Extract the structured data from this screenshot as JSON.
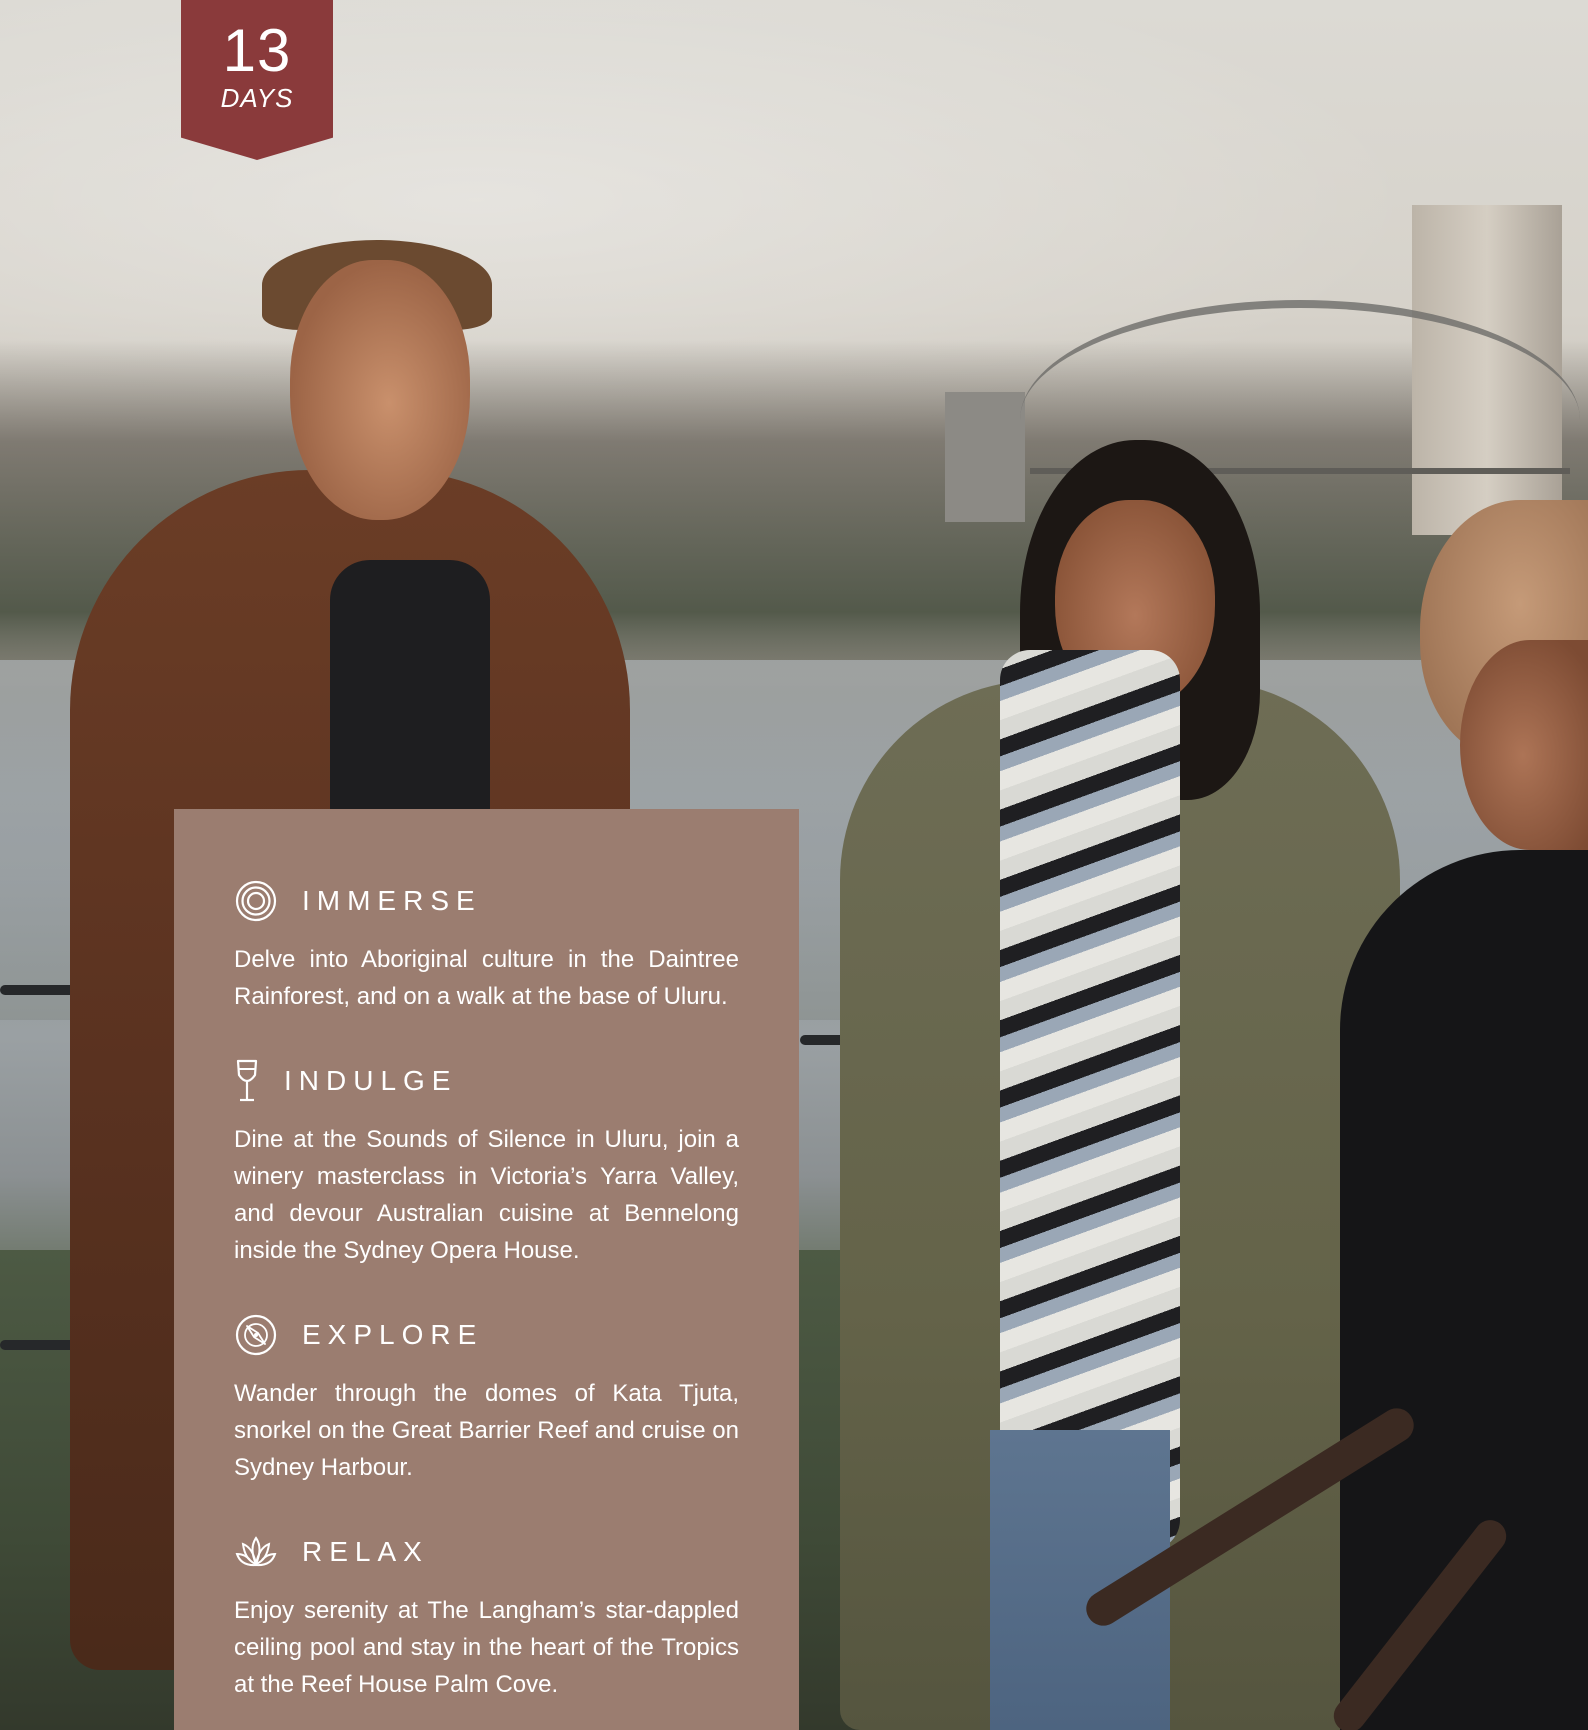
{
  "badge": {
    "number": "13",
    "label": "DAYS"
  },
  "sections": [
    {
      "icon": "concentric-circles-icon",
      "title": "IMMERSE",
      "text": "Delve into Aboriginal culture in the Daintree Rainforest, and on a walk at the base of Uluru."
    },
    {
      "icon": "wine-glass-icon",
      "title": "INDULGE",
      "text": "Dine at the Sounds of Silence in Uluru, join a winery masterclass in Victoria’s Yarra Valley, and devour Australian cuisine at Bennelong inside the Sydney Opera House."
    },
    {
      "icon": "compass-icon",
      "title": "EXPLORE",
      "text": "Wander through the domes of Kata Tjuta, snorkel on the Great Barrier Reef and cruise on Sydney Harbour."
    },
    {
      "icon": "lotus-icon",
      "title": "RELAX",
      "text": "Enjoy serenity at The Langham’s star-dappled ceiling pool and stay in the heart of the Tropics at the Reef House Palm Cove."
    }
  ],
  "colors": {
    "badge": "#8a3a3b",
    "panel": "#9b7d70",
    "text": "#ffffff"
  }
}
